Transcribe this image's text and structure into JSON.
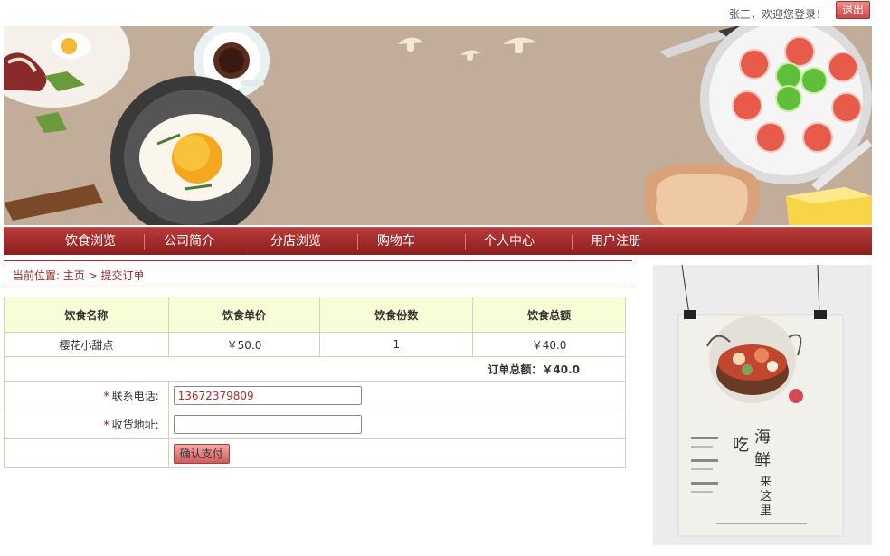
{
  "header": {
    "welcome": "张三，欢迎您登录！",
    "logout_label": "退出"
  },
  "nav": {
    "items": [
      {
        "label": "饮食浏览"
      },
      {
        "label": "公司简介"
      },
      {
        "label": "分店浏览"
      },
      {
        "label": "购物车"
      },
      {
        "label": "个人中心"
      },
      {
        "label": "用户注册"
      }
    ]
  },
  "breadcrumb": "当前位置: 主页 > 提交订单",
  "order": {
    "columns": [
      "饮食名称",
      "饮食单价",
      "饮食份数",
      "饮食总额"
    ],
    "rows": [
      {
        "name": "樱花小甜点",
        "price": "￥50.0",
        "qty": "1",
        "amount": "￥40.0"
      }
    ],
    "total": "订单总额：￥40.0"
  },
  "form": {
    "phone_label": "联系电话:",
    "phone_value": "13672379809",
    "address_label": "收货地址:",
    "address_value": "",
    "required_mark": "*",
    "submit_label": "确认支付"
  },
  "poster": {
    "title_chars": [
      "吃",
      "海",
      "鲜",
      "来",
      "这",
      "里"
    ]
  },
  "colors": {
    "nav_bg": "#a02a2a",
    "breadcrumb": "#9a2d2d",
    "table_header": "#f8fdd8",
    "banner_bg": "#c1ad99"
  }
}
